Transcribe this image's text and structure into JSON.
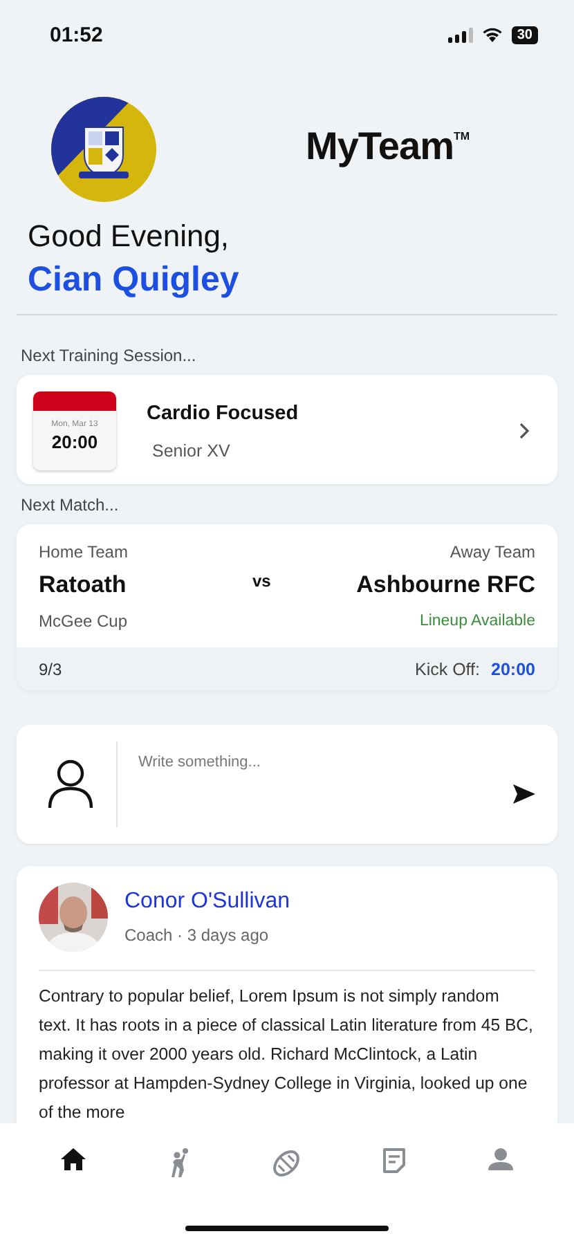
{
  "status_bar": {
    "time": "01:52",
    "battery": "30"
  },
  "header": {
    "app_name": "MyTeam",
    "trademark": "TM",
    "greeting": "Good Evening,",
    "user_name": "Cian Quigley"
  },
  "training": {
    "section_label": "Next Training Session...",
    "date": "Mon, Mar 13",
    "time": "20:00",
    "title": "Cardio Focused",
    "squad": "Senior XV"
  },
  "match": {
    "section_label": "Next Match...",
    "home_label": "Home Team",
    "home_team": "Ratoath",
    "versus": "vs",
    "away_label": "Away Team",
    "away_team": "Ashbourne RFC",
    "competition": "McGee Cup",
    "lineup_status": "Lineup Available",
    "date": "9/3",
    "kickoff_label": "Kick Off:",
    "kickoff_time": "20:00"
  },
  "composer": {
    "placeholder": "Write something..."
  },
  "posts": [
    {
      "author": "Conor O'Sullivan",
      "meta": "Coach · 3 days ago",
      "body": "Contrary to popular belief, Lorem Ipsum is not simply random text. It has roots in a piece of classical Latin literature from 45 BC, making it over 2000 years old. Richard McClintock, a Latin professor at Hampden-Sydney College in Virginia, looked up one of the more"
    }
  ],
  "nav": [
    {
      "kind": "home",
      "selected": true
    },
    {
      "kind": "player",
      "selected": false
    },
    {
      "kind": "ball",
      "selected": false
    },
    {
      "kind": "notes",
      "selected": false
    },
    {
      "kind": "profile",
      "selected": false
    }
  ]
}
